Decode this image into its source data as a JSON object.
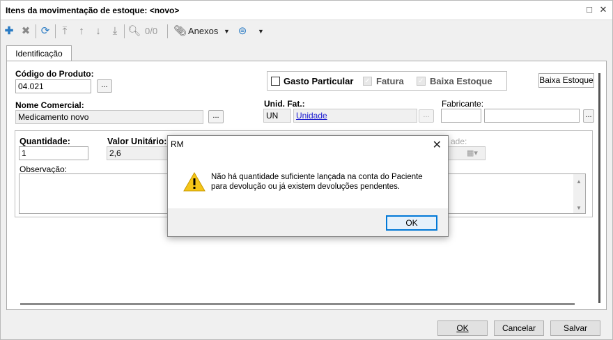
{
  "window": {
    "title": "Itens da movimentação de estoque: <novo>"
  },
  "toolbar": {
    "counter": "0/0",
    "anexos_label": "Anexos"
  },
  "tabs": [
    {
      "label": "Identificação"
    }
  ],
  "form": {
    "codigo_label": "Código do Produto:",
    "codigo_value": "04.021",
    "nome_label": "Nome Comercial:",
    "nome_value": "Medicamento novo",
    "unid_label": "Unid. Fat.:",
    "unid_code": "UN",
    "unid_name": "Unidade",
    "fabricante_label": "Fabricante:",
    "fabricante_code": "",
    "fabricante_name": "",
    "gasto_label": "Gasto Particular",
    "fatura_label": "Fatura",
    "baixa_label": "Baixa Estoque",
    "baixa_button": "Baixa Estoque",
    "quantidade_label": "Quantidade:",
    "quantidade_value": "1",
    "valor_label": "Valor Unitário:",
    "valor_value": "2,6",
    "partial_label": "ade:",
    "observacao_label": "Observação:",
    "browse": "..."
  },
  "footer": {
    "ok": "OK",
    "cancelar": "Cancelar",
    "salvar": "Salvar"
  },
  "dialog": {
    "title": "RM",
    "message_line1": "Não há quantidade suficiente lançada na conta do Paciente",
    "message_line2": "para devolução ou já existem devoluções pendentes.",
    "ok": "OK"
  }
}
